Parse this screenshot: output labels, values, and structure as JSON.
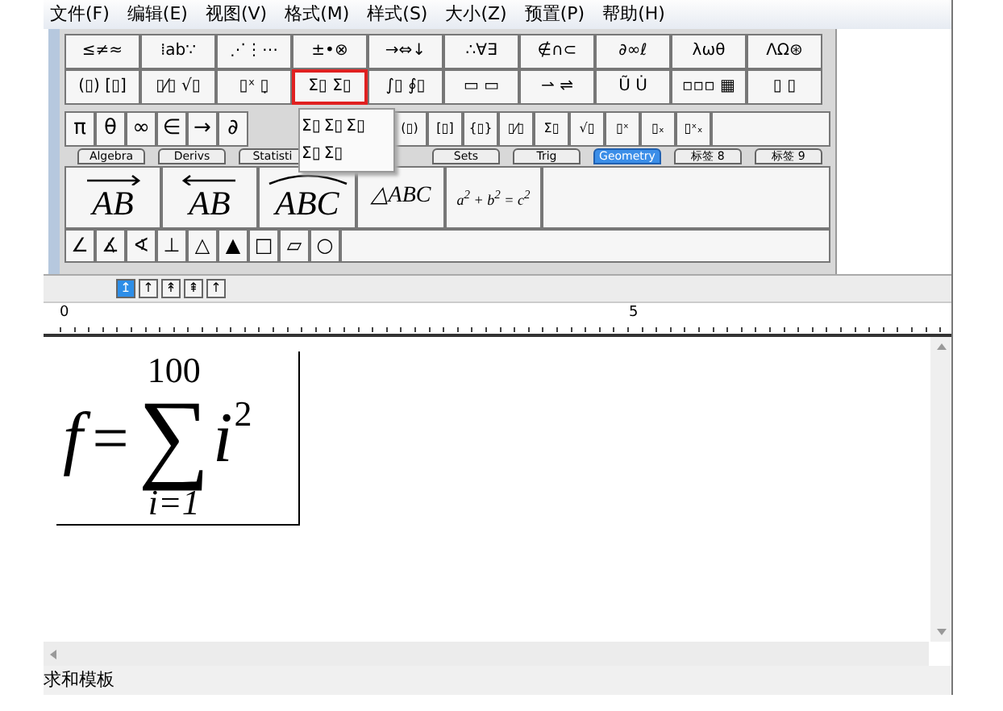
{
  "menu": [
    "文件(F)",
    "编辑(E)",
    "视图(V)",
    "格式(M)",
    "样式(S)",
    "大小(Z)",
    "预置(P)",
    "帮助(H)"
  ],
  "palette_rows": [
    {
      "buttons": [
        {
          "label": "≤≠≈",
          "selected": false
        },
        {
          "label": "⁞ab∵",
          "selected": false
        },
        {
          "label": "⋰⋮⋯",
          "selected": false
        },
        {
          "label": "±•⊗",
          "selected": false
        },
        {
          "label": "→⇔↓",
          "selected": false
        },
        {
          "label": "∴∀∃",
          "selected": false
        },
        {
          "label": "∉∩⊂",
          "selected": false
        },
        {
          "label": "∂∞ℓ",
          "selected": false
        },
        {
          "label": "λωθ",
          "selected": false
        },
        {
          "label": "ΛΩ⊛",
          "selected": false
        }
      ]
    },
    {
      "buttons": [
        {
          "label": "(▯) [▯]",
          "selected": false
        },
        {
          "label": "▯⁄▯ √▯",
          "selected": false
        },
        {
          "label": "▯ˣ ▯̣",
          "selected": false
        },
        {
          "label": "Σ▯ Σ▯",
          "selected": true
        },
        {
          "label": "∫▯ ∮▯",
          "selected": false
        },
        {
          "label": "▭ ▭",
          "selected": false
        },
        {
          "label": "⇀ ⇌",
          "selected": false
        },
        {
          "label": "Ũ U̇",
          "selected": false
        },
        {
          "label": "▫▫▫ ▦",
          "selected": false
        },
        {
          "label": "▯ ▯",
          "selected": false
        }
      ]
    }
  ],
  "symbol_row": {
    "before_popup": [
      "π",
      "θ",
      "∞",
      "∈",
      "→",
      "∂"
    ],
    "after_popup": [
      "(▯)",
      "[▯]",
      "{▯}",
      "▯⁄▯",
      "Σ▯",
      "√▯",
      "▯ˣ",
      "▯ₓ",
      "▯ˣₓ"
    ]
  },
  "template_popup": {
    "rows": [
      [
        "Σ▯",
        "Σ▯",
        "Σ▯"
      ],
      [
        "Σ▯",
        "Σ▯"
      ]
    ]
  },
  "tabs": {
    "before_popup": [
      {
        "label": "Algebra",
        "selected": false
      },
      {
        "label": "Derivs",
        "selected": false
      },
      {
        "label": "Statisti",
        "selected": false
      }
    ],
    "after_popup": [
      {
        "label": "Sets",
        "selected": false
      },
      {
        "label": "Trig",
        "selected": false
      },
      {
        "label": "Geometry",
        "selected": true
      },
      {
        "label": "标签 8",
        "selected": false
      },
      {
        "label": "标签 9",
        "selected": false
      }
    ]
  },
  "geometry_templates": [
    {
      "kind": "right_arrow",
      "label": "AB"
    },
    {
      "kind": "left_arrow",
      "label": "AB"
    },
    {
      "kind": "arc",
      "label": "ABC"
    },
    {
      "kind": "plain",
      "label": "△ABC"
    },
    {
      "kind": "formula",
      "label": "a$^{2}$ + b$^{2}$ = c$^{2}$"
    }
  ],
  "geometry_symbols": [
    "∠",
    "∡",
    "∢",
    "⊥",
    "△",
    "▲",
    "□",
    "▱",
    "○"
  ],
  "alignment_buttons": [
    {
      "label": "↥",
      "selected": true
    },
    {
      "label": "↑",
      "selected": false
    },
    {
      "label": "↟",
      "selected": false
    },
    {
      "label": "⇞",
      "selected": false
    },
    {
      "label": "↑",
      "selected": false
    }
  ],
  "ruler": {
    "labels": [
      "0",
      "5"
    ]
  },
  "equation": {
    "lhs": "f",
    "relation": "=",
    "operator": "∑",
    "upper": "100",
    "lower": "i=1",
    "body": "i",
    "exponent": "2"
  },
  "status_bar": "求和模板"
}
